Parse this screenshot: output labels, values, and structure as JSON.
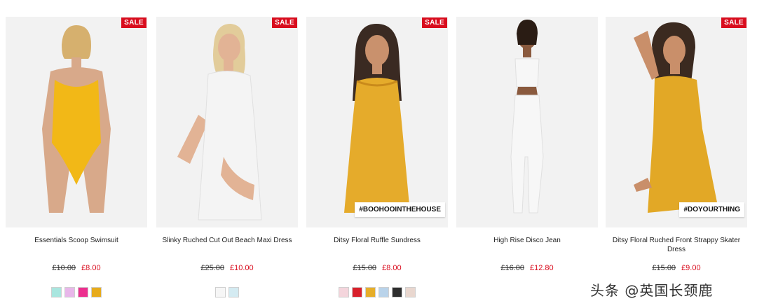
{
  "products": [
    {
      "name": "Essentials Scoop Swimsuit",
      "old_price": "£10.00",
      "new_price": "£8.00",
      "sale_badge": "SALE",
      "tag": "",
      "swatches": [
        "#a9e6df",
        "#e8b7ea",
        "#ec2f8e",
        "#e7ab1c"
      ],
      "garment_color": "#f2b817"
    },
    {
      "name": "Slinky Ruched Cut Out Beach Maxi Dress",
      "old_price": "£25.00",
      "new_price": "£10.00",
      "sale_badge": "SALE",
      "tag": "",
      "swatches": [
        "#f6f6f6",
        "#d4ebf2"
      ],
      "garment_color": "#f4f4f4"
    },
    {
      "name": "Ditsy Floral Ruffle Sundress",
      "old_price": "£15.00",
      "new_price": "£8.00",
      "sale_badge": "SALE",
      "tag": "#BOOHOOINTHEHOUSE",
      "swatches": [
        "#f4d5dc",
        "#d8202b",
        "#e6ae2a",
        "#b9d3ea",
        "#2e2e2e",
        "#e9d7cf"
      ],
      "garment_color": "#e5ab2b"
    },
    {
      "name": "High Rise Disco Jean",
      "old_price": "£16.00",
      "new_price": "£12.80",
      "sale_badge": "",
      "tag": "",
      "swatches": [],
      "garment_color": "#f7f7f7"
    },
    {
      "name": "Ditsy Floral Ruched Front Strappy Skater Dress",
      "old_price": "£15.00",
      "new_price": "£9.00",
      "sale_badge": "SALE",
      "tag": "#DOYOURTHING",
      "swatches": [],
      "garment_color": "#e2a826"
    }
  ],
  "watermark": "头条 @英国长颈鹿",
  "colors": {
    "sale_red": "#d90d1e",
    "image_bg": "#f2f2f2"
  }
}
